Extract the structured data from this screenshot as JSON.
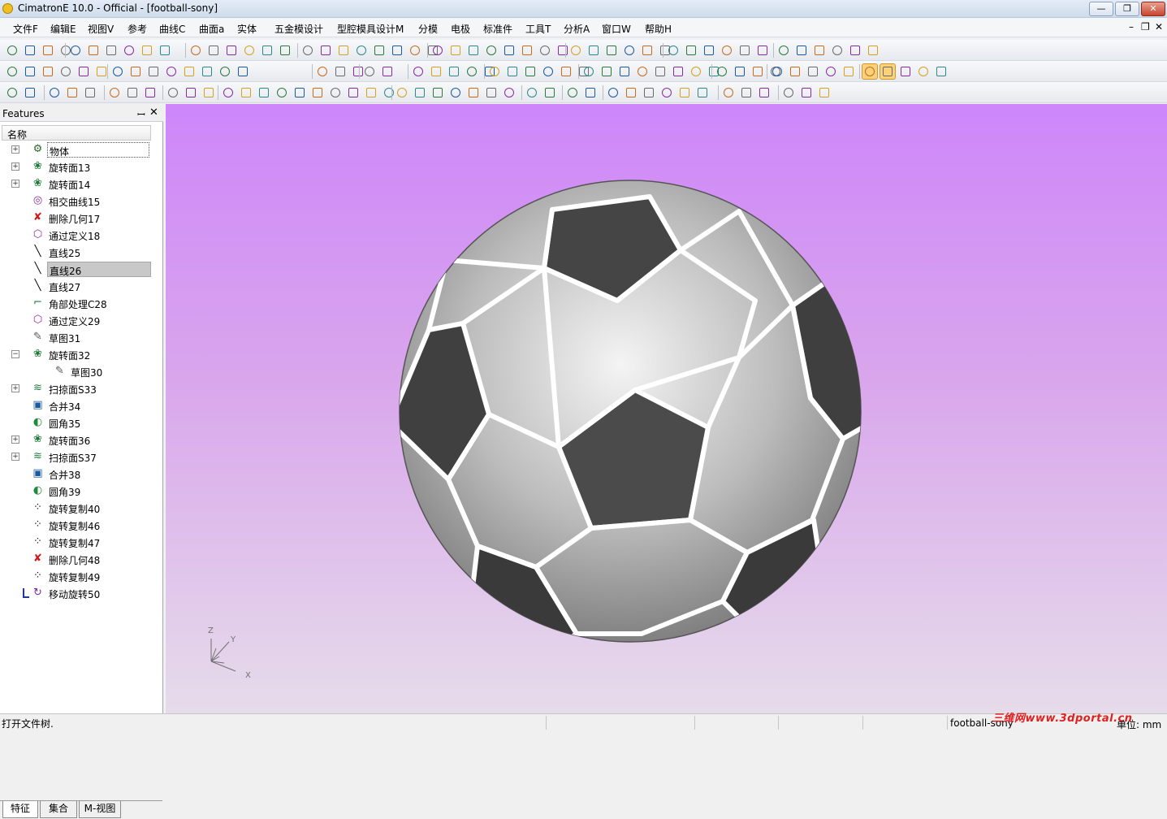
{
  "window": {
    "title": "CimatronE 10.0 - Official - [football-sony]",
    "minimize": "—",
    "restore": "❐",
    "close": "✕"
  },
  "menu": {
    "items": [
      "文件F",
      "编辑E",
      "视图V",
      "参考",
      "曲线C",
      "曲面a",
      "实体",
      "五金模设计",
      "型腔模具设计M",
      "分模",
      "电极",
      "标准件",
      "工具T",
      "分析A",
      "窗口W",
      "帮助H"
    ],
    "mdi_minimize": "–",
    "mdi_restore": "❐",
    "mdi_close": "✕"
  },
  "panel": {
    "title": "Features",
    "pin": "ꟷ",
    "close": "✕",
    "column_header": "名称"
  },
  "tree": [
    {
      "label": "物体",
      "icon": "object-icon",
      "expander": "+",
      "state": "outline"
    },
    {
      "label": "旋转面13",
      "icon": "revolve-face-icon",
      "expander": "+"
    },
    {
      "label": "旋转面14",
      "icon": "revolve-face-icon",
      "expander": "+"
    },
    {
      "label": "相交曲线15",
      "icon": "intersect-curve-icon"
    },
    {
      "label": "删除几何17",
      "icon": "delete-geometry-icon"
    },
    {
      "label": "通过定义18",
      "icon": "through-define-icon"
    },
    {
      "label": "直线25",
      "icon": "line-icon"
    },
    {
      "label": "直线26",
      "icon": "line-icon",
      "state": "selected"
    },
    {
      "label": "直线27",
      "icon": "line-icon"
    },
    {
      "label": "角部处理C28",
      "icon": "corner-icon"
    },
    {
      "label": "通过定义29",
      "icon": "through-define-icon"
    },
    {
      "label": "草图31",
      "icon": "sketch-icon"
    },
    {
      "label": "旋转面32",
      "icon": "revolve-face-icon",
      "expander": "−"
    },
    {
      "label": "草图30",
      "icon": "sketch-icon",
      "child": true
    },
    {
      "label": "扫掠面S33",
      "icon": "sweep-face-icon",
      "expander": "+"
    },
    {
      "label": "合并34",
      "icon": "combine-icon"
    },
    {
      "label": "圆角35",
      "icon": "fillet-icon"
    },
    {
      "label": "旋转面36",
      "icon": "revolve-face-icon",
      "expander": "+"
    },
    {
      "label": "扫掠面S37",
      "icon": "sweep-face-icon",
      "expander": "+"
    },
    {
      "label": "合并38",
      "icon": "combine-icon"
    },
    {
      "label": "圆角39",
      "icon": "fillet-icon"
    },
    {
      "label": "旋转复制40",
      "icon": "rotate-copy-icon"
    },
    {
      "label": "旋转复制46",
      "icon": "rotate-copy-icon"
    },
    {
      "label": "旋转复制47",
      "icon": "rotate-copy-icon"
    },
    {
      "label": "删除几何48",
      "icon": "delete-geometry-icon"
    },
    {
      "label": "旋转复制49",
      "icon": "rotate-copy-icon"
    },
    {
      "label": "移动旋转50",
      "icon": "move-rotate-icon",
      "marker": true
    }
  ],
  "tabs": [
    "特征",
    "集合",
    "M-视图"
  ],
  "triad": {
    "x": "X",
    "y": "Y",
    "z": "Z"
  },
  "status": {
    "message": "打开文件树.",
    "filename": "football-sony",
    "units": "单位: mm",
    "watermark": "三维网www.3dportal.cn"
  },
  "colors": {
    "viewport_top": "#ce86fa",
    "viewport_bottom": "#e6dcea",
    "toolbar_active": "#fbd27a",
    "selected_row": "#c8c8c8"
  }
}
